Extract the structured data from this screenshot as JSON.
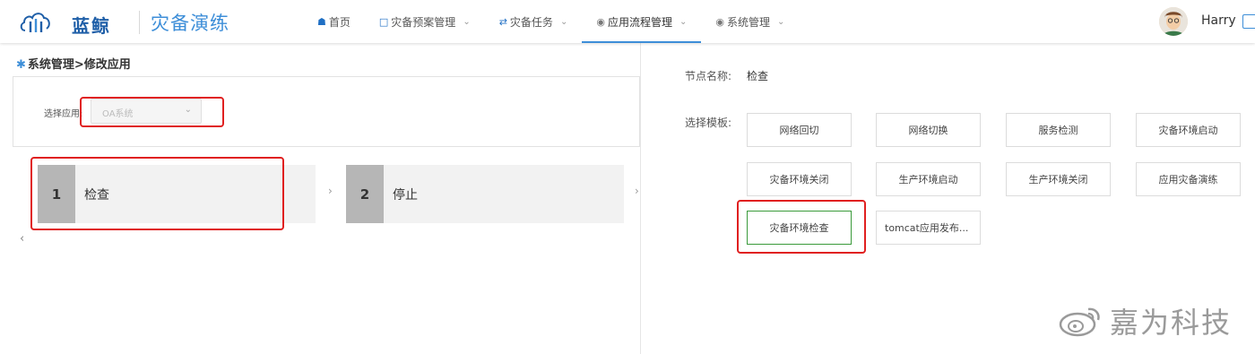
{
  "header": {
    "brand": "蓝鲸",
    "product": "灾备演练",
    "user": "Harry"
  },
  "nav": [
    {
      "label": "首页",
      "icon": "home-icon"
    },
    {
      "label": "灾备预案管理",
      "icon": "document-icon"
    },
    {
      "label": "灾备任务",
      "icon": "swap-icon"
    },
    {
      "label": "应用流程管理",
      "icon": "circle-icon"
    },
    {
      "label": "系统管理",
      "icon": "circle-icon"
    }
  ],
  "breadcrumb": "系统管理>修改应用",
  "app_select": {
    "label": "选择应用:",
    "value": "OA系统"
  },
  "steps": [
    {
      "num": "1",
      "name": "检查"
    },
    {
      "num": "2",
      "name": "停止"
    }
  ],
  "node": {
    "name_label": "节点名称:",
    "name_value": "检查",
    "template_label": "选择模板:"
  },
  "templates": [
    "网络回切",
    "网络切换",
    "服务检测",
    "灾备环境启动",
    "灾备环境关闭",
    "生产环境启动",
    "生产环境关闭",
    "应用灾备演练",
    "灾备环境检查",
    "tomcat应用发布..."
  ],
  "selected_template": "灾备环境检查",
  "watermark": "嘉为科技",
  "colors": {
    "accent": "#3d8ed8",
    "highlight": "#e02020",
    "selected_border": "#3a9a3a"
  }
}
